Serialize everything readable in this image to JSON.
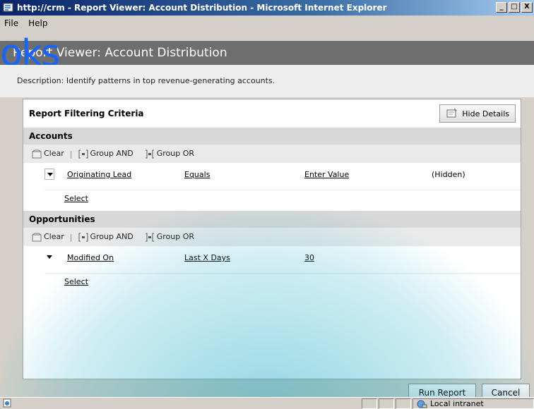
{
  "window": {
    "title": "http://crm - Report Viewer: Account Distribution - Microsoft Internet Explorer",
    "min": "_",
    "max": "□",
    "close": "X"
  },
  "menu": {
    "file": "File",
    "help": "Help"
  },
  "header": {
    "title": "Report Viewer: Account Distribution",
    "watermark": "oks"
  },
  "description": "Description: Identify patterns in top revenue-generating accounts.",
  "panel": {
    "title": "Report Filtering Criteria",
    "hide_details": "Hide Details"
  },
  "toolbar": {
    "clear": "Clear",
    "group_and": "Group AND",
    "group_or": "Group OR",
    "separator": "|"
  },
  "accounts": {
    "label": "Accounts",
    "row": {
      "field": "Originating Lead",
      "operator": "Equals",
      "value": "Enter Value",
      "status": "(Hidden)"
    },
    "select": "Select"
  },
  "opportunities": {
    "label": "Opportunities",
    "row": {
      "field": "Modified On",
      "operator": "Last X Days",
      "value": "30"
    },
    "select": "Select"
  },
  "footer": {
    "run": "Run Report",
    "cancel": "Cancel"
  },
  "status": {
    "zone": "Local intranet"
  }
}
